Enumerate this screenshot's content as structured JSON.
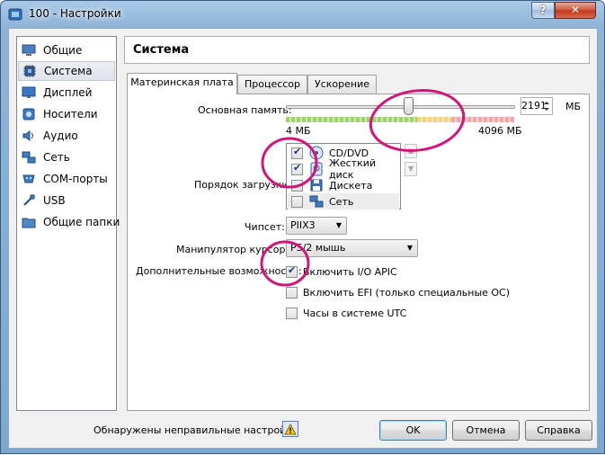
{
  "window": {
    "title": "100 - Настройки",
    "help_label": "?",
    "close_label": "✕"
  },
  "sidebar": {
    "items": [
      {
        "label": "Общие",
        "icon": "monitor-icon"
      },
      {
        "label": "Система",
        "icon": "chip-icon"
      },
      {
        "label": "Дисплей",
        "icon": "display-icon"
      },
      {
        "label": "Носители",
        "icon": "storage-icon"
      },
      {
        "label": "Аудио",
        "icon": "audio-icon"
      },
      {
        "label": "Сеть",
        "icon": "network-icon"
      },
      {
        "label": "COM-порты",
        "icon": "serial-port-icon"
      },
      {
        "label": "USB",
        "icon": "usb-icon"
      },
      {
        "label": "Общие папки",
        "icon": "folder-icon"
      }
    ],
    "selected": "Система"
  },
  "section": {
    "title": "Система"
  },
  "tabs": [
    {
      "label": "Материнская плата",
      "active": true
    },
    {
      "label": "Процессор",
      "active": false
    },
    {
      "label": "Ускорение",
      "active": false
    }
  ],
  "memory": {
    "label": "Основная память:",
    "value": "2191",
    "unit": "МБ",
    "min_label": "4 МБ",
    "max_label": "4096 МБ",
    "fraction": 0.535
  },
  "boot": {
    "label": "Порядок загрузки:",
    "items": [
      {
        "label": "CD/DVD",
        "checked": true,
        "icon": "optical-disc-icon"
      },
      {
        "label": "Жесткий диск",
        "checked": true,
        "icon": "hard-disk-icon"
      },
      {
        "label": "Дискета",
        "checked": false,
        "icon": "floppy-icon"
      },
      {
        "label": "Сеть",
        "checked": false,
        "icon": "network-icon"
      }
    ]
  },
  "chipset": {
    "label": "Чипсет:",
    "value": "PIIX3"
  },
  "pointer": {
    "label": "Манипулятор курсора:",
    "value": "PS/2 мышь"
  },
  "features": {
    "label": "Дополнительные возможности:",
    "items": [
      {
        "label": "Включить I/O APIC",
        "checked": true
      },
      {
        "label": "Включить EFI (только специальные ОС)",
        "checked": false
      },
      {
        "label": "Часы в системе UTC",
        "checked": false
      }
    ]
  },
  "footer": {
    "warning": "Обнаружены неправильные настройки",
    "ok": "OK",
    "cancel": "Отмена",
    "help": "Справка"
  },
  "colors": {
    "annotation": "#d4147a",
    "scale_green": "#9ed36a",
    "scale_red": "#f4a4a4"
  }
}
